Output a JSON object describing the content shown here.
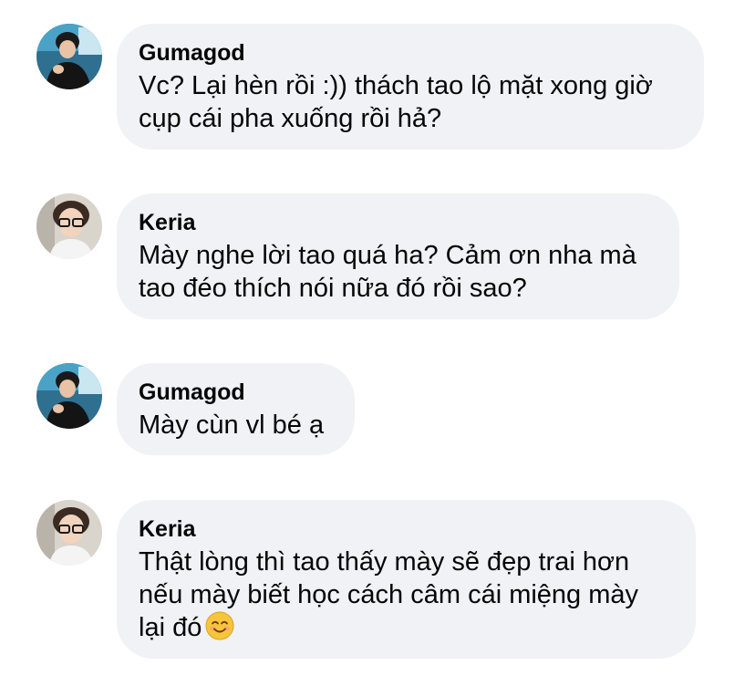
{
  "messages": [
    {
      "author": "Gumagod",
      "avatar_icon": "gumagod-avatar",
      "lines": [
        "Vc? Lại hèn rồi :)) thách tao lộ mặt xong giờ",
        "cụp cái pha xuống rồi hả?"
      ]
    },
    {
      "author": "Keria",
      "avatar_icon": "keria-avatar",
      "lines": [
        "Mày nghe lời tao quá ha? Cảm ơn nha mà",
        "tao đéo thích nói nữa đó rồi sao?"
      ]
    },
    {
      "author": "Gumagod",
      "avatar_icon": "gumagod-avatar",
      "lines": [
        "Mày cùn vl bé ạ"
      ]
    },
    {
      "author": "Keria",
      "avatar_icon": "keria-avatar",
      "lines": [
        "Thật lòng thì tao thấy mày sẽ đẹp trai hơn",
        "nếu mày biết học cách câm cái miệng mày",
        "lại đó"
      ],
      "trailing_emoji": "smiling-face-emoji"
    }
  ]
}
